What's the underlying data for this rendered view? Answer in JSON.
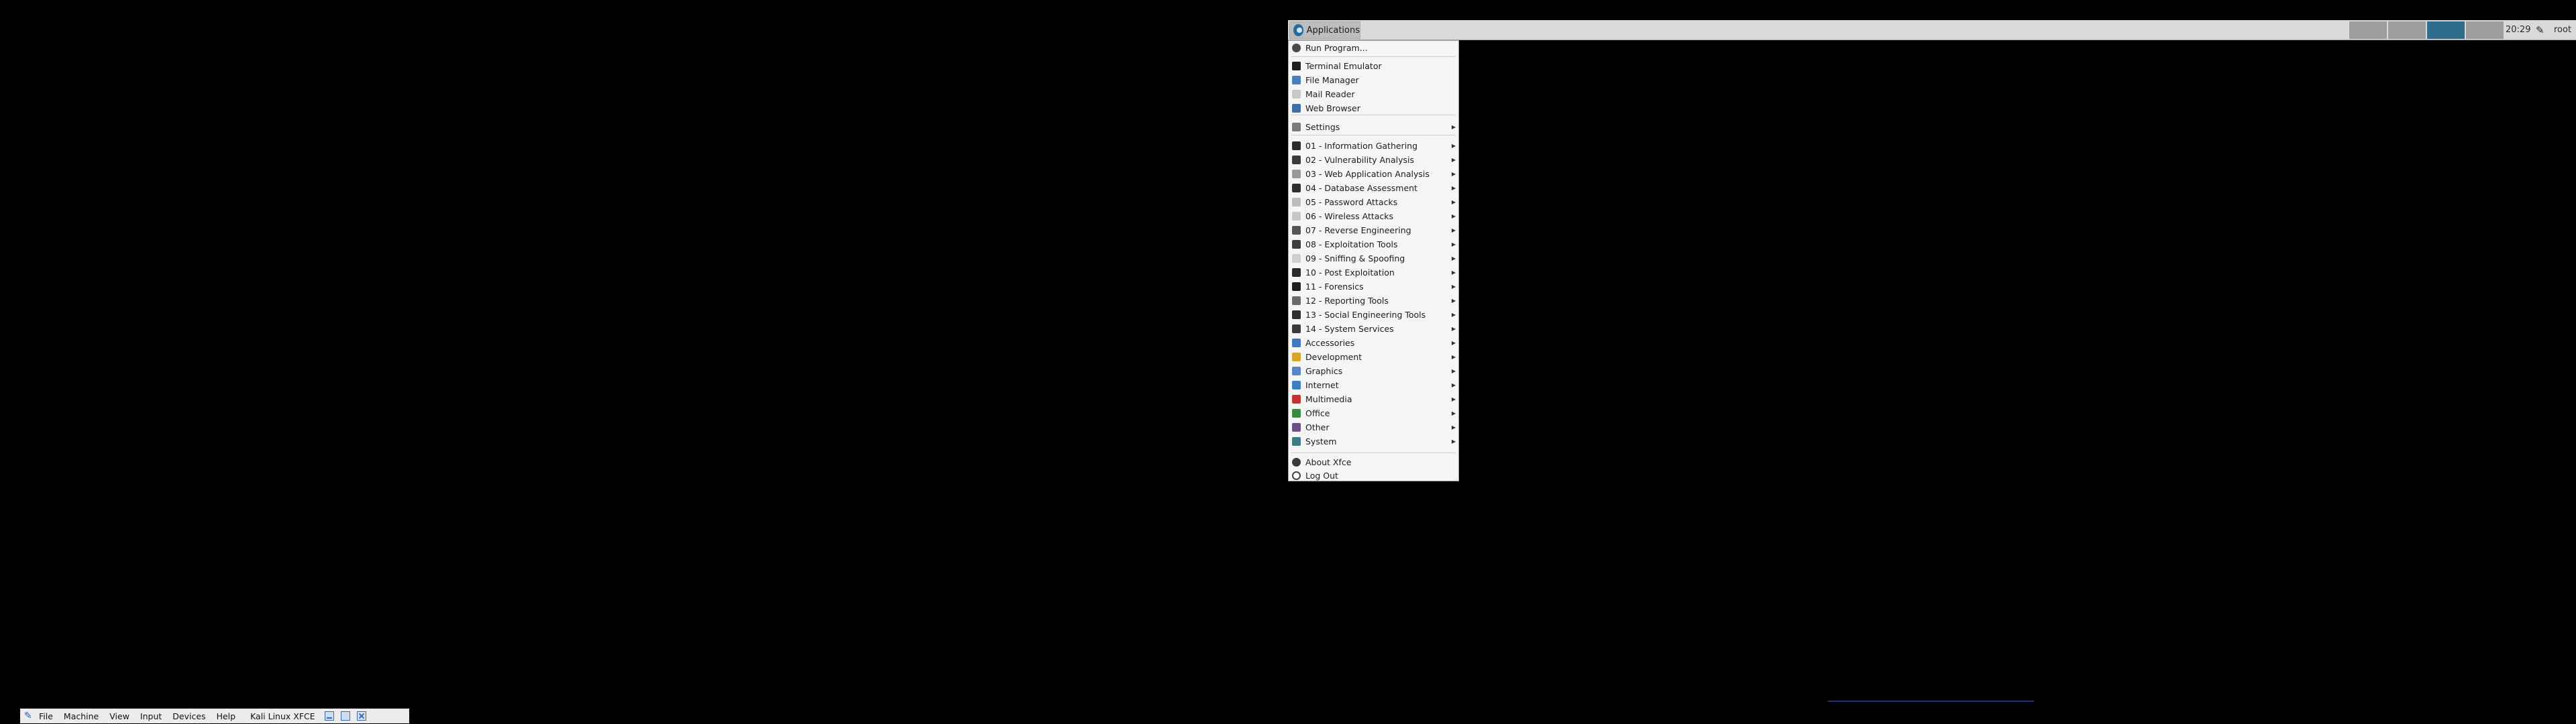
{
  "panel": {
    "applications_label": "Applications",
    "clock": "20:29",
    "user": "root",
    "accent_color": "#2f6d8e"
  },
  "menu": {
    "run_program": "Run Program...",
    "items_group1": [
      {
        "label": "Terminal Emulator",
        "icon": "terminal-icon",
        "color": "#1e1e1e"
      },
      {
        "label": "File Manager",
        "icon": "folder-icon",
        "color": "#4a7ec0"
      },
      {
        "label": "Mail Reader",
        "icon": "mail-icon",
        "color": "#c9c9c9"
      },
      {
        "label": "Web Browser",
        "icon": "globe-icon",
        "color": "#3d6ea8"
      }
    ],
    "settings": "Settings",
    "categories": [
      {
        "label": "01 - Information Gathering",
        "icon": "magnifier-icon",
        "color": "#2b2b2b"
      },
      {
        "label": "02 - Vulnerability Analysis",
        "icon": "bug-icon",
        "color": "#3a3a3a"
      },
      {
        "label": "03 - Web Application Analysis",
        "icon": "web-app-icon",
        "color": "#9a9a9a"
      },
      {
        "label": "04 - Database Assessment",
        "icon": "database-icon",
        "color": "#2f2f2f"
      },
      {
        "label": "05 - Password Attacks",
        "icon": "key-icon",
        "color": "#bdbdbd"
      },
      {
        "label": "06 - Wireless Attacks",
        "icon": "wireless-icon",
        "color": "#c7c7c7"
      },
      {
        "label": "07 - Reverse Engineering",
        "icon": "gears-icon",
        "color": "#555555"
      },
      {
        "label": "08 - Exploitation Tools",
        "icon": "exploit-icon",
        "color": "#3c3c3c"
      },
      {
        "label": "09 - Sniffing & Spoofing",
        "icon": "sniff-icon",
        "color": "#cfcfcf"
      },
      {
        "label": "10 - Post Exploitation",
        "icon": "post-exploit-icon",
        "color": "#2a2a2a"
      },
      {
        "label": "11 - Forensics",
        "icon": "hand-icon",
        "color": "#1f1f1f"
      },
      {
        "label": "12 - Reporting Tools",
        "icon": "report-icon",
        "color": "#6a6a6a"
      },
      {
        "label": "13 - Social Engineering Tools",
        "icon": "social-icon",
        "color": "#2d2d2d"
      },
      {
        "label": "14 - System Services",
        "icon": "services-icon",
        "color": "#3a3a3a"
      },
      {
        "label": "Accessories",
        "icon": "accessories-icon",
        "color": "#3f79c2"
      },
      {
        "label": "Development",
        "icon": "development-icon",
        "color": "#d8a32a"
      },
      {
        "label": "Graphics",
        "icon": "graphics-icon",
        "color": "#5a86c9"
      },
      {
        "label": "Internet",
        "icon": "internet-icon",
        "color": "#3f7fbf"
      },
      {
        "label": "Multimedia",
        "icon": "multimedia-icon",
        "color": "#c8322e"
      },
      {
        "label": "Office",
        "icon": "office-icon",
        "color": "#3b8a3e"
      },
      {
        "label": "Other",
        "icon": "other-icon",
        "color": "#6a4f8a"
      },
      {
        "label": "System",
        "icon": "system-icon",
        "color": "#3f7a83"
      }
    ],
    "about": "About Xfce",
    "logout": "Log Out"
  },
  "vbox": {
    "menus": [
      "File",
      "Machine",
      "View",
      "Input",
      "Devices",
      "Help"
    ],
    "title": "Kali Linux XFCE"
  }
}
